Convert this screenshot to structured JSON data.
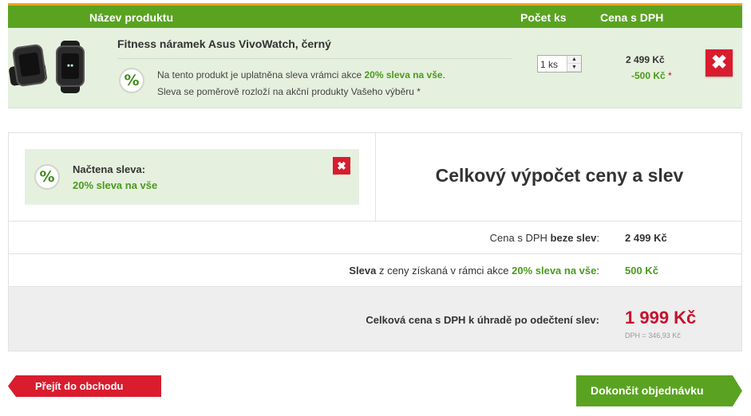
{
  "header": {
    "col_name": "Název produktu",
    "col_qty": "Počet ks",
    "col_price": "Cena s DPH"
  },
  "product": {
    "title": "Fitness náramek Asus VivoWatch, černý",
    "promo_prefix": "Na tento produkt je uplatněna sleva vrámci akce ",
    "promo_name": "20% sleva na vše",
    "promo_suffix": ".",
    "promo_note": "Sleva se poměrově rozloží na akční produkty Vašeho výběru *",
    "quantity": "1 ks",
    "price": "2 499 Kč",
    "discount": "-500 Kč",
    "discount_mark": "*",
    "badge": "%",
    "remove": "✖"
  },
  "coupon": {
    "label": "Načtena sleva:",
    "value": "20% sleva na vše",
    "badge": "%",
    "remove": "✖"
  },
  "summary": {
    "title": "Celkový výpočet ceny a slev",
    "row1_prefix": "Cena s DPH ",
    "row1_bold": "beze slev",
    "row1_suffix": ":",
    "row1_value": "2 499 Kč",
    "row2_bold": "Sleva",
    "row2_middle": " z ceny získaná v rámci akce ",
    "row2_promo": "20% sleva na vše",
    "row2_suffix": ":",
    "row2_value": "500 Kč",
    "row3_label": "Celková cena s DPH k úhradě po odečtení slev:",
    "total": "1 999 Kč",
    "vat": "DPH = 346,93 Kč"
  },
  "buttons": {
    "back": "Přejít do obchodu",
    "finish": "Dokončit objednávku"
  },
  "colors": {
    "green": "#5aa321",
    "red": "#d91c2e",
    "accent_orange": "#f0a21e"
  }
}
